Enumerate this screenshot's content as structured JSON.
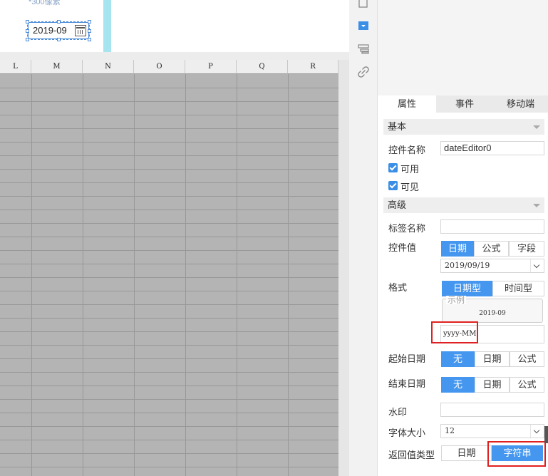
{
  "canvas": {
    "px_label": "*300像素",
    "date_editor_value": "2019-09"
  },
  "sheet": {
    "columns": [
      "L",
      "M",
      "N",
      "O",
      "P",
      "Q",
      "R"
    ]
  },
  "toolbar": {
    "icons": [
      "resize-icon",
      "dropdown-widget-icon",
      "layers-icon",
      "link-icon"
    ]
  },
  "panel": {
    "tabs": [
      "属性",
      "事件",
      "移动端"
    ],
    "active_tab": "属性",
    "basic": {
      "section_label": "基本",
      "name_label": "控件名称",
      "name_value": "dateEditor0",
      "enabled_label": "可用",
      "visible_label": "可见"
    },
    "advanced": {
      "section_label": "高级",
      "tag_name_label": "标签名称",
      "tag_name_value": "",
      "value_label": "控件值",
      "value_types": [
        "日期",
        "公式",
        "字段"
      ],
      "value_date": "2019/09/19",
      "format_label": "格式",
      "format_types": [
        "日期型",
        "时间型"
      ],
      "example_legend": "示例",
      "example_value": "2019-09",
      "format_value": "yyyy-MM",
      "start_date_label": "起始日期",
      "start_options": [
        "无",
        "日期",
        "公式"
      ],
      "end_date_label": "结束日期",
      "end_options": [
        "无",
        "日期",
        "公式"
      ],
      "watermark_label": "水印",
      "watermark_value": "",
      "font_size_label": "字体大小",
      "font_size_value": "12",
      "return_type_label": "返回值类型",
      "return_types": [
        "日期",
        "字符串"
      ]
    },
    "colors": {
      "accent": "#4496ef",
      "highlight_box": "#e02020"
    }
  }
}
